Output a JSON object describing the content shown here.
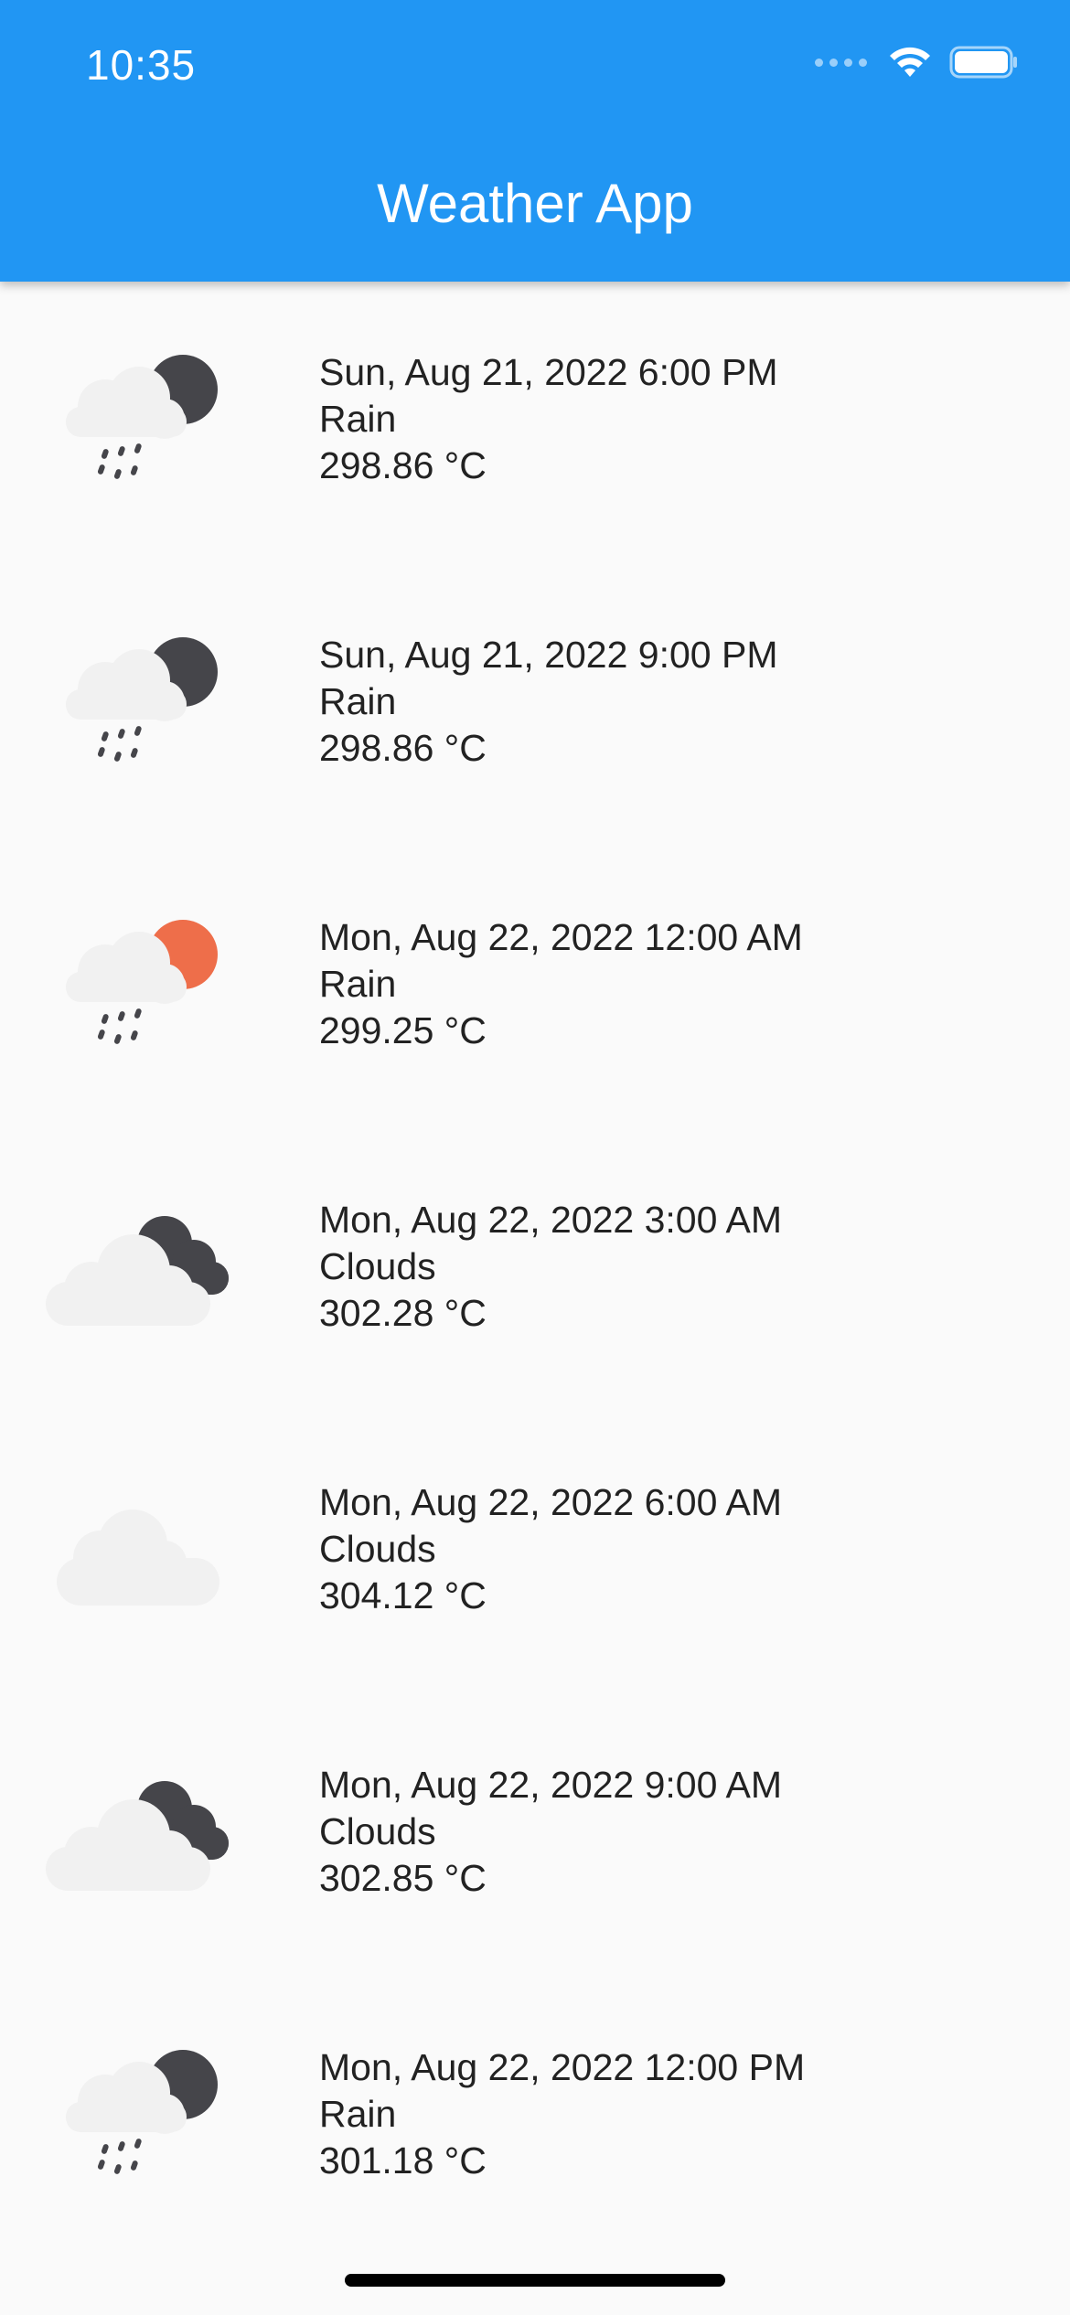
{
  "status_bar": {
    "time": "10:35"
  },
  "app_bar": {
    "title": "Weather App"
  },
  "forecast": [
    {
      "datetime": "Sun, Aug 21, 2022 6:00 PM",
      "condition": "Rain",
      "temperature": "298.86 °C",
      "icon": "rain-night-icon"
    },
    {
      "datetime": "Sun, Aug 21, 2022 9:00 PM",
      "condition": "Rain",
      "temperature": "298.86 °C",
      "icon": "rain-night-icon"
    },
    {
      "datetime": "Mon, Aug 22, 2022 12:00 AM",
      "condition": "Rain",
      "temperature": "299.25 °C",
      "icon": "rain-sun-icon"
    },
    {
      "datetime": "Mon, Aug 22, 2022 3:00 AM",
      "condition": "Clouds",
      "temperature": "302.28 °C",
      "icon": "broken-clouds-icon"
    },
    {
      "datetime": "Mon, Aug 22, 2022 6:00 AM",
      "condition": "Clouds",
      "temperature": "304.12 °C",
      "icon": "cloud-icon"
    },
    {
      "datetime": "Mon, Aug 22, 2022 9:00 AM",
      "condition": "Clouds",
      "temperature": "302.85 °C",
      "icon": "broken-clouds-icon"
    },
    {
      "datetime": "Mon, Aug 22, 2022 12:00 PM",
      "condition": "Rain",
      "temperature": "301.18 °C",
      "icon": "rain-night-icon"
    }
  ],
  "colors": {
    "app_bar": "#2196f3",
    "background": "#fafafa",
    "cloud": "#f1f1f1",
    "dark_cloud": "#45454a",
    "sun": "#ee6e4a"
  }
}
